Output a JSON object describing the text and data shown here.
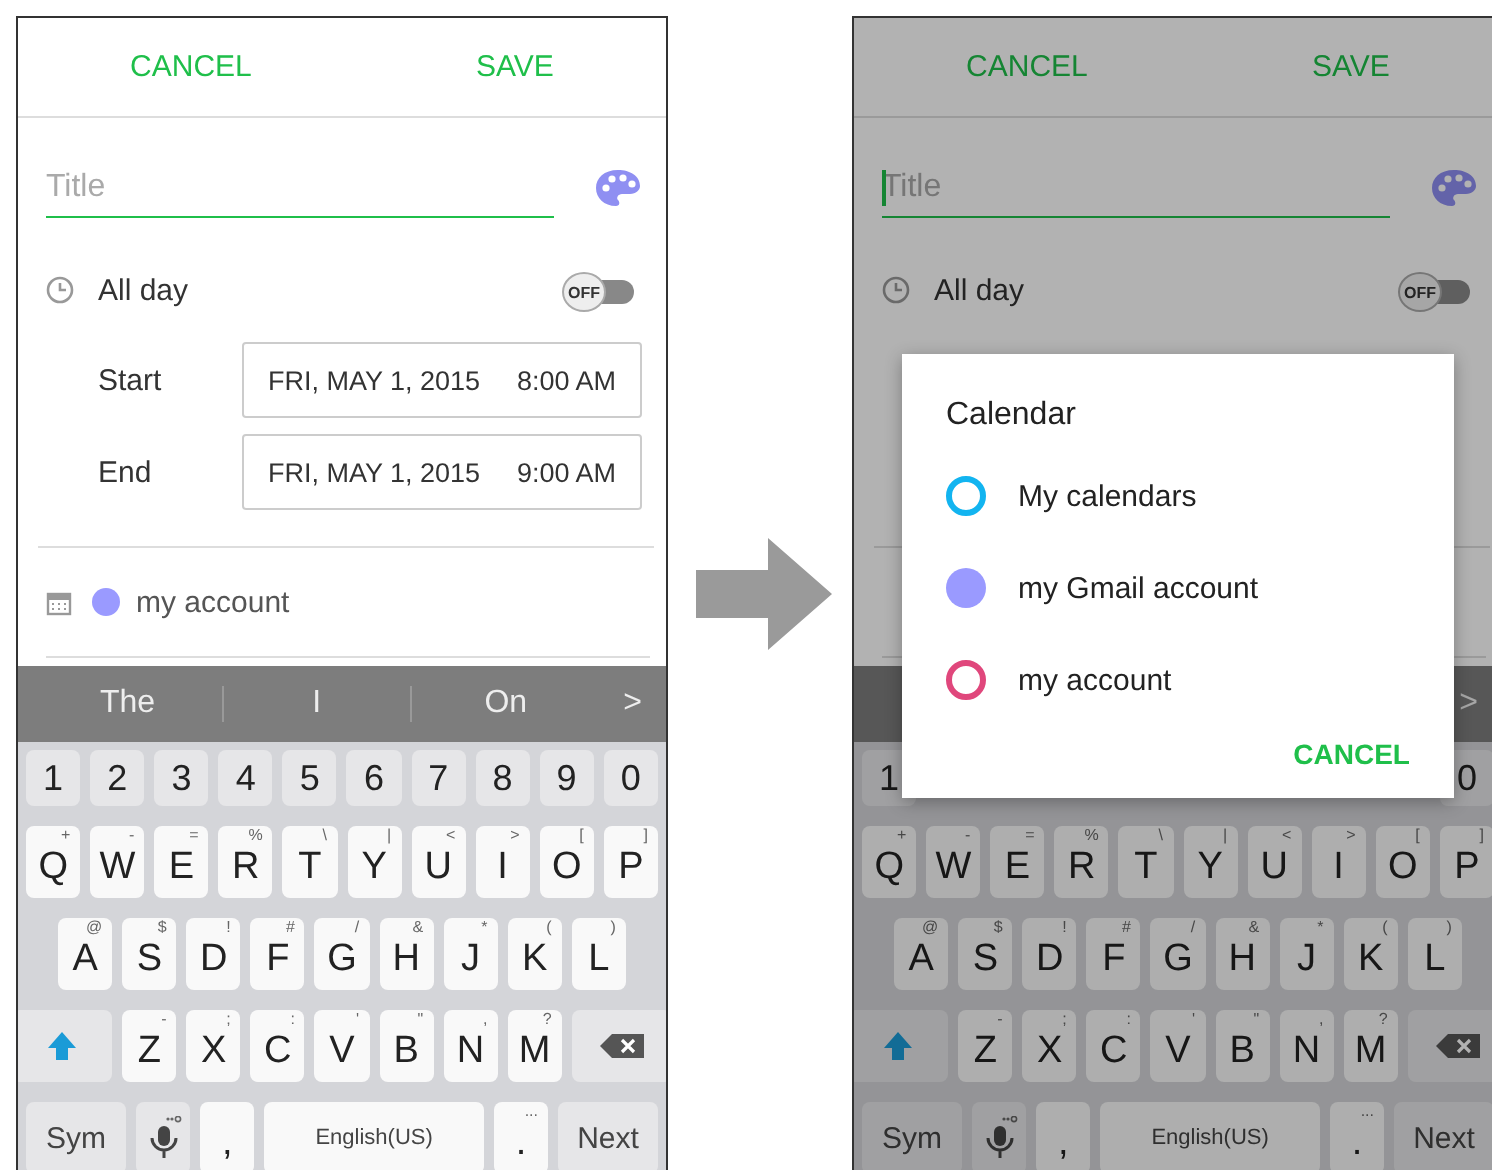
{
  "screens": [
    {
      "dimmed": false,
      "actions": [
        {
          "label": "CANCEL"
        },
        {
          "label": "SAVE"
        }
      ],
      "title_field": {
        "placeholder": "Title",
        "cursor": false
      },
      "all_day": {
        "label": "All day",
        "on": false,
        "switch_text": "OFF"
      },
      "times": [
        {
          "label": "Start",
          "date": "FRI, MAY 1, 2015",
          "time": "8:00 AM"
        },
        {
          "label": "End",
          "date": "FRI, MAY 1, 2015",
          "time": "9:00 AM"
        }
      ],
      "calendar": {
        "name": "my account",
        "color": "#9a9aff"
      },
      "suggestions": [
        "The",
        "I",
        "On"
      ],
      "suggestion_more": ">",
      "keyboard": [
        {
          "kind": "numbers",
          "keys": [
            {
              "kind": "number",
              "label": "1"
            },
            {
              "kind": "number",
              "label": "2"
            },
            {
              "kind": "number",
              "label": "3"
            },
            {
              "kind": "number",
              "label": "4"
            },
            {
              "kind": "number",
              "label": "5"
            },
            {
              "kind": "number",
              "label": "6"
            },
            {
              "kind": "number",
              "label": "7"
            },
            {
              "kind": "number",
              "label": "8"
            },
            {
              "kind": "number",
              "label": "9"
            },
            {
              "kind": "number",
              "label": "0"
            }
          ]
        },
        {
          "kind": "letters",
          "keys": [
            {
              "kind": "letter",
              "label": "Q",
              "hint": "+"
            },
            {
              "kind": "letter",
              "label": "W",
              "hint": "-"
            },
            {
              "kind": "letter",
              "label": "E",
              "hint": "="
            },
            {
              "kind": "letter",
              "label": "R",
              "hint": "%"
            },
            {
              "kind": "letter",
              "label": "T",
              "hint": "\\"
            },
            {
              "kind": "letter",
              "label": "Y",
              "hint": "|"
            },
            {
              "kind": "letter",
              "label": "U",
              "hint": "<"
            },
            {
              "kind": "letter",
              "label": "I",
              "hint": ">"
            },
            {
              "kind": "letter",
              "label": "O",
              "hint": "["
            },
            {
              "kind": "letter",
              "label": "P",
              "hint": "]"
            }
          ]
        },
        {
          "kind": "letters",
          "keys": [
            {
              "kind": "letter",
              "label": "A",
              "hint": "@"
            },
            {
              "kind": "letter",
              "label": "S",
              "hint": "$"
            },
            {
              "kind": "letter",
              "label": "D",
              "hint": "!"
            },
            {
              "kind": "letter",
              "label": "F",
              "hint": "#"
            },
            {
              "kind": "letter",
              "label": "G",
              "hint": "/"
            },
            {
              "kind": "letter",
              "label": "H",
              "hint": "&"
            },
            {
              "kind": "letter",
              "label": "J",
              "hint": "*"
            },
            {
              "kind": "letter",
              "label": "K",
              "hint": "("
            },
            {
              "kind": "letter",
              "label": "L",
              "hint": ")"
            }
          ]
        },
        {
          "kind": "letters",
          "keys": [
            {
              "kind": "shift"
            },
            {
              "kind": "letter",
              "label": "Z",
              "hint": "-"
            },
            {
              "kind": "letter",
              "label": "X",
              "hint": ";"
            },
            {
              "kind": "letter",
              "label": "C",
              "hint": ":"
            },
            {
              "kind": "letter",
              "label": "V",
              "hint": "'"
            },
            {
              "kind": "letter",
              "label": "B",
              "hint": "\""
            },
            {
              "kind": "letter",
              "label": "N",
              "hint": ","
            },
            {
              "kind": "letter",
              "label": "M",
              "hint": "?"
            },
            {
              "kind": "backspace"
            }
          ]
        },
        {
          "kind": "bottom",
          "keys": [
            {
              "kind": "fn",
              "label": "Sym"
            },
            {
              "kind": "mic"
            },
            {
              "kind": "char",
              "label": ","
            },
            {
              "kind": "space",
              "label": "English(US)"
            },
            {
              "kind": "char",
              "label": ".",
              "hint": "..."
            },
            {
              "kind": "fn",
              "label": "Next"
            }
          ]
        }
      ]
    },
    {
      "dimmed": true,
      "actions": [
        {
          "label": "CANCEL"
        },
        {
          "label": "SAVE"
        }
      ],
      "title_field": {
        "placeholder": "Title",
        "cursor": true
      },
      "all_day": {
        "label": "All day",
        "on": false,
        "switch_text": "OFF"
      },
      "suggestion_more": ">",
      "keyboard": [
        {
          "kind": "numbers",
          "keys": [
            {
              "kind": "number",
              "label": "1"
            },
            {
              "kind": "number",
              "label": "0"
            }
          ]
        },
        {
          "kind": "letters",
          "keys": [
            {
              "kind": "letter",
              "label": "Q",
              "hint": "+"
            },
            {
              "kind": "letter",
              "label": "W",
              "hint": "-"
            },
            {
              "kind": "letter",
              "label": "E",
              "hint": "="
            },
            {
              "kind": "letter",
              "label": "R",
              "hint": "%"
            },
            {
              "kind": "letter",
              "label": "T",
              "hint": "\\"
            },
            {
              "kind": "letter",
              "label": "Y",
              "hint": "|"
            },
            {
              "kind": "letter",
              "label": "U",
              "hint": "<"
            },
            {
              "kind": "letter",
              "label": "I",
              "hint": ">"
            },
            {
              "kind": "letter",
              "label": "O",
              "hint": "["
            },
            {
              "kind": "letter",
              "label": "P",
              "hint": "]"
            }
          ]
        },
        {
          "kind": "letters",
          "keys": [
            {
              "kind": "letter",
              "label": "A",
              "hint": "@"
            },
            {
              "kind": "letter",
              "label": "S",
              "hint": "$"
            },
            {
              "kind": "letter",
              "label": "D",
              "hint": "!"
            },
            {
              "kind": "letter",
              "label": "F",
              "hint": "#"
            },
            {
              "kind": "letter",
              "label": "G",
              "hint": "/"
            },
            {
              "kind": "letter",
              "label": "H",
              "hint": "&"
            },
            {
              "kind": "letter",
              "label": "J",
              "hint": "*"
            },
            {
              "kind": "letter",
              "label": "K",
              "hint": "("
            },
            {
              "kind": "letter",
              "label": "L",
              "hint": ")"
            }
          ]
        },
        {
          "kind": "letters",
          "keys": [
            {
              "kind": "shift"
            },
            {
              "kind": "letter",
              "label": "Z",
              "hint": "-"
            },
            {
              "kind": "letter",
              "label": "X",
              "hint": ";"
            },
            {
              "kind": "letter",
              "label": "C",
              "hint": ":"
            },
            {
              "kind": "letter",
              "label": "V",
              "hint": "'"
            },
            {
              "kind": "letter",
              "label": "B",
              "hint": "\""
            },
            {
              "kind": "letter",
              "label": "N",
              "hint": ","
            },
            {
              "kind": "letter",
              "label": "M",
              "hint": "?"
            },
            {
              "kind": "backspace"
            }
          ]
        },
        {
          "kind": "bottom",
          "keys": [
            {
              "kind": "fn",
              "label": "Sym"
            },
            {
              "kind": "mic"
            },
            {
              "kind": "char",
              "label": ","
            },
            {
              "kind": "space",
              "label": "English(US)"
            },
            {
              "kind": "char",
              "label": ".",
              "hint": "..."
            },
            {
              "kind": "fn",
              "label": "Next"
            }
          ]
        }
      ],
      "dialog": {
        "title": "Calendar",
        "items": [
          {
            "name": "My calendars",
            "kind": "ring",
            "color": "#12b4f0"
          },
          {
            "name": "my Gmail account",
            "kind": "dot",
            "color": "#9a9aff"
          },
          {
            "name": "my account",
            "kind": "ring",
            "color": "#e0477c"
          }
        ],
        "button": "CANCEL"
      }
    }
  ]
}
